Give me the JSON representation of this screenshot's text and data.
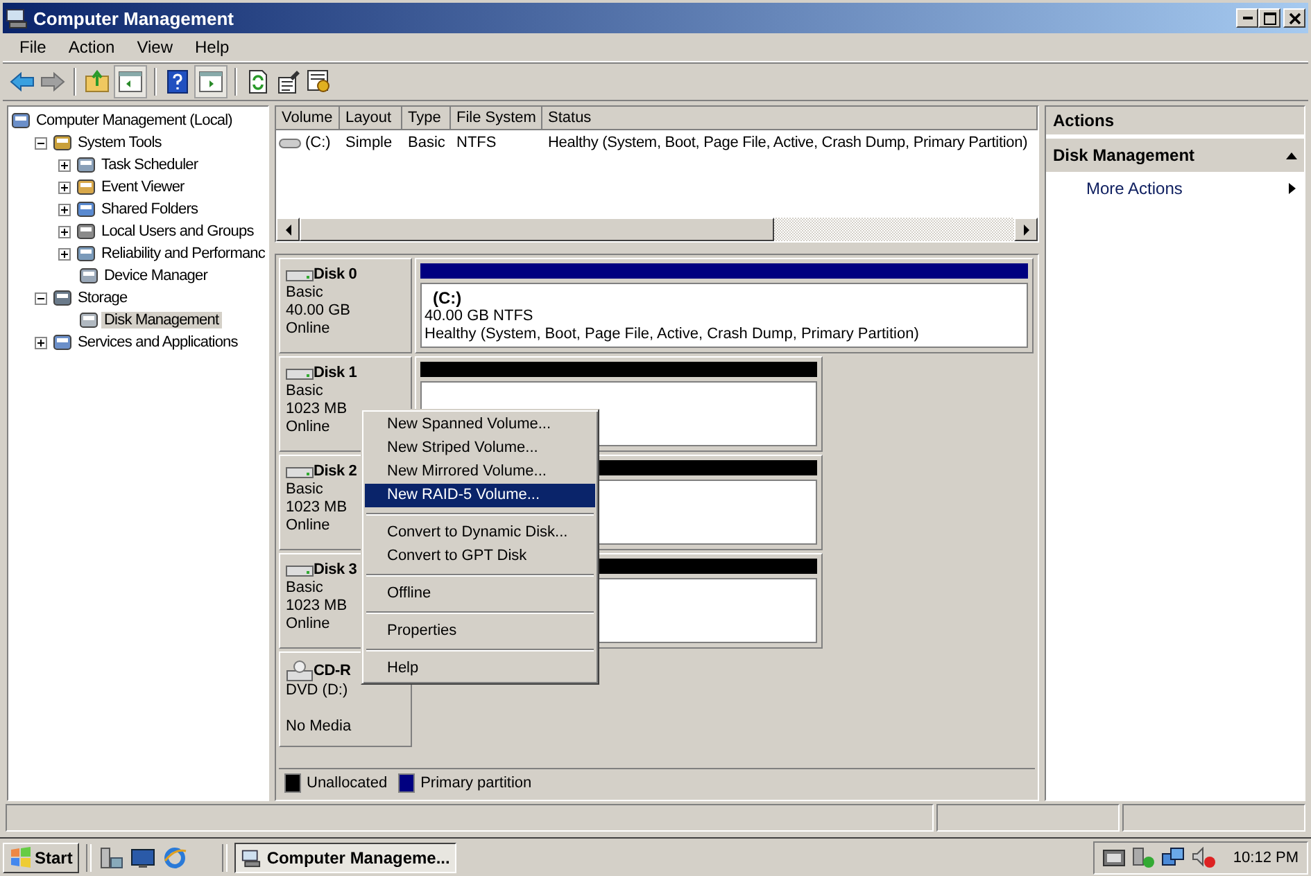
{
  "window": {
    "title": "Computer Management"
  },
  "menu": [
    "File",
    "Action",
    "View",
    "Help"
  ],
  "tree": [
    {
      "label": "Computer Management (Local)",
      "selected": false,
      "children": [
        {
          "label": "System Tools",
          "expanded": true,
          "selected": false,
          "children": [
            {
              "label": "Task Scheduler",
              "expanded": false,
              "selected": false
            },
            {
              "label": "Event Viewer",
              "expanded": false,
              "selected": false
            },
            {
              "label": "Shared Folders",
              "expanded": false,
              "selected": false
            },
            {
              "label": "Local Users and Groups",
              "expanded": false,
              "selected": false
            },
            {
              "label": "Reliability and Performanc",
              "expanded": false,
              "selected": false
            },
            {
              "label": "Device Manager",
              "selected": false
            }
          ]
        },
        {
          "label": "Storage",
          "expanded": true,
          "selected": false,
          "children": [
            {
              "label": "Disk Management",
              "selected": true
            }
          ]
        },
        {
          "label": "Services and Applications",
          "expanded": false,
          "selected": false
        }
      ]
    }
  ],
  "volume_table": {
    "columns": [
      "Volume",
      "Layout",
      "Type",
      "File System",
      "Status"
    ],
    "rows": [
      [
        "(C:)",
        "Simple",
        "Basic",
        "NTFS",
        "Healthy (System, Boot, Page File, Active, Crash Dump, Primary Partition)"
      ]
    ]
  },
  "disks": [
    {
      "kind": "disk",
      "name": "Disk 0",
      "type": "Basic",
      "size": "40.00 GB",
      "status": "Online",
      "partitions": [
        {
          "kind": "primary",
          "label": "(C:)",
          "size": "40.00 GB NTFS",
          "status": "Healthy (System, Boot, Page File, Active, Crash Dump, Primary Partition)"
        }
      ]
    },
    {
      "kind": "disk",
      "name": "Disk 1",
      "type": "Basic",
      "size": "1023 MB",
      "status": "Online",
      "partitions": [
        {
          "kind": "unallocated"
        }
      ]
    },
    {
      "kind": "disk",
      "name": "Disk 2",
      "type": "Basic",
      "size": "1023 MB",
      "status": "Online",
      "partitions": [
        {
          "kind": "unallocated"
        }
      ]
    },
    {
      "kind": "disk",
      "name": "Disk 3",
      "type": "Basic",
      "size": "1023 MB",
      "status": "Online",
      "partitions": [
        {
          "kind": "unallocated"
        }
      ]
    },
    {
      "kind": "cdrom",
      "name": "CD-R",
      "type": "DVD (D:)",
      "status": "No Media"
    }
  ],
  "legend": [
    {
      "label": "Unallocated",
      "color": "#000000"
    },
    {
      "label": "Primary partition",
      "color": "#000080"
    }
  ],
  "context_menu": [
    {
      "kind": "item",
      "label": "New Spanned Volume...",
      "selected": false
    },
    {
      "kind": "item",
      "label": "New Striped Volume...",
      "selected": false
    },
    {
      "kind": "item",
      "label": "New Mirrored Volume...",
      "selected": false
    },
    {
      "kind": "item",
      "label": "New RAID-5 Volume...",
      "selected": true
    },
    {
      "kind": "separator"
    },
    {
      "kind": "item",
      "label": "Convert to Dynamic Disk...",
      "selected": false
    },
    {
      "kind": "item",
      "label": "Convert to GPT Disk",
      "selected": false
    },
    {
      "kind": "separator"
    },
    {
      "kind": "item",
      "label": "Offline",
      "selected": false
    },
    {
      "kind": "separator"
    },
    {
      "kind": "item",
      "label": "Properties",
      "selected": false
    },
    {
      "kind": "separator"
    },
    {
      "kind": "item",
      "label": "Help",
      "selected": false
    }
  ],
  "actions": {
    "title": "Actions",
    "sections": [
      {
        "label": "Disk Management",
        "expanded": true,
        "items": [
          "More Actions"
        ]
      }
    ]
  },
  "taskbar": {
    "start": "Start",
    "tasks": [
      "Computer Manageme..."
    ],
    "clock": "10:12 PM"
  }
}
